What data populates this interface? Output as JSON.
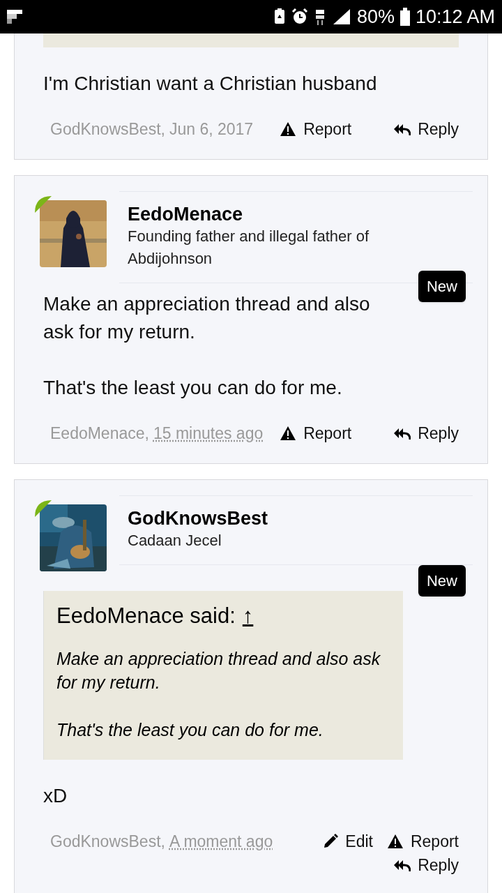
{
  "status_bar": {
    "battery": "80%",
    "time": "10:12 AM"
  },
  "posts": [
    {
      "quote": {
        "cut_off": true
      },
      "body": [
        "I'm Christian want a Christian husband"
      ],
      "footer": {
        "author": "GodKnowsBest,",
        "date": "Jun 6, 2017",
        "date_underlined": false,
        "actions": [
          {
            "kind": "report",
            "label": "Report"
          },
          {
            "kind": "reply",
            "label": "Reply"
          }
        ]
      }
    },
    {
      "user": {
        "name": "EedoMenace",
        "title": "Founding father and illegal father of Abdijohnson"
      },
      "new_badge": "New",
      "body": [
        "Make an appreciation thread and also ask for my return.",
        "That's the least you can do for me."
      ],
      "footer": {
        "author": "EedoMenace,",
        "date": "15 minutes ago",
        "date_underlined": true,
        "actions": [
          {
            "kind": "report",
            "label": "Report"
          },
          {
            "kind": "reply",
            "label": "Reply"
          }
        ]
      }
    },
    {
      "user": {
        "name": "GodKnowsBest",
        "title": "Cadaan Jecel"
      },
      "new_badge": "New",
      "quote": {
        "cut_off": false,
        "attribution": "EedoMenace said:",
        "link": "↑",
        "paragraphs": [
          "Make an appreciation thread and also ask for my return.",
          "That's the least you can do for me."
        ]
      },
      "body": [
        "xD"
      ],
      "footer": {
        "author": "GodKnowsBest,",
        "date": "A moment ago",
        "date_underlined": true,
        "actions": [
          {
            "kind": "edit",
            "label": "Edit"
          },
          {
            "kind": "report",
            "label": "Report"
          },
          {
            "kind": "reply",
            "label": "Reply"
          }
        ]
      }
    }
  ]
}
